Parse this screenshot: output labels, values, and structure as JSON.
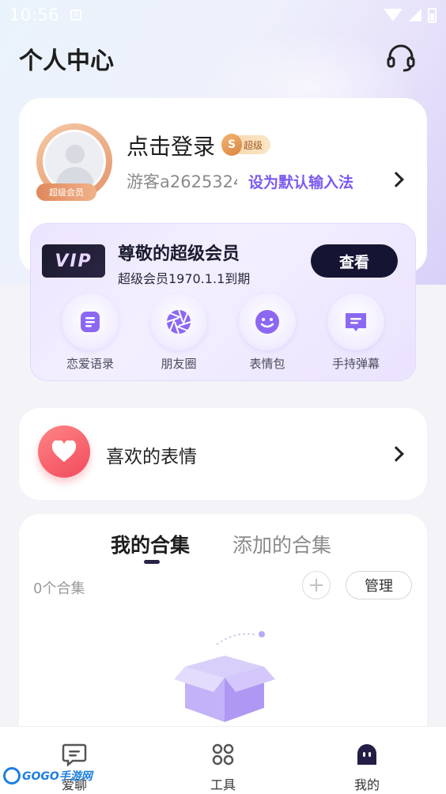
{
  "status_bar": {
    "time": "10:56",
    "notif_glyph": "A"
  },
  "header": {
    "title": "个人中心",
    "support_icon": "headset-icon"
  },
  "profile": {
    "login_label": "点击登录",
    "badge_letter": "S",
    "badge_label": "超级",
    "avatar_ribbon": "超级会员",
    "guest_id": "游客a2625324",
    "set_default_ime": "设为默认输入法"
  },
  "vip": {
    "logo": "VIP",
    "title": "尊敬的超级会员",
    "subtitle": "超级会员1970.1.1到期",
    "view_button": "查看",
    "tools": [
      {
        "label": "恋爱语录",
        "icon": "notes-icon"
      },
      {
        "label": "朋友圈",
        "icon": "aperture-icon"
      },
      {
        "label": "表情包",
        "icon": "smiley-icon"
      },
      {
        "label": "手持弹幕",
        "icon": "message-icon"
      }
    ]
  },
  "favorites": {
    "label": "喜欢的表情",
    "icon": "heart-icon"
  },
  "collections": {
    "tabs": [
      {
        "label": "我的合集",
        "active": true
      },
      {
        "label": "添加的合集",
        "active": false
      }
    ],
    "count_text": "0个合集",
    "add_symbol": "+",
    "manage_label": "管理"
  },
  "tabbar": {
    "items": [
      {
        "label": "爱聊",
        "icon": "chat-icon"
      },
      {
        "label": "工具",
        "icon": "grid-icon"
      },
      {
        "label": "我的",
        "icon": "ghost-icon",
        "active": true
      }
    ]
  },
  "watermark": {
    "text": "GOGO手游网"
  },
  "colors": {
    "accent": "#7a5af0",
    "dark_button": "#151433",
    "heart": "#f14a5c"
  }
}
